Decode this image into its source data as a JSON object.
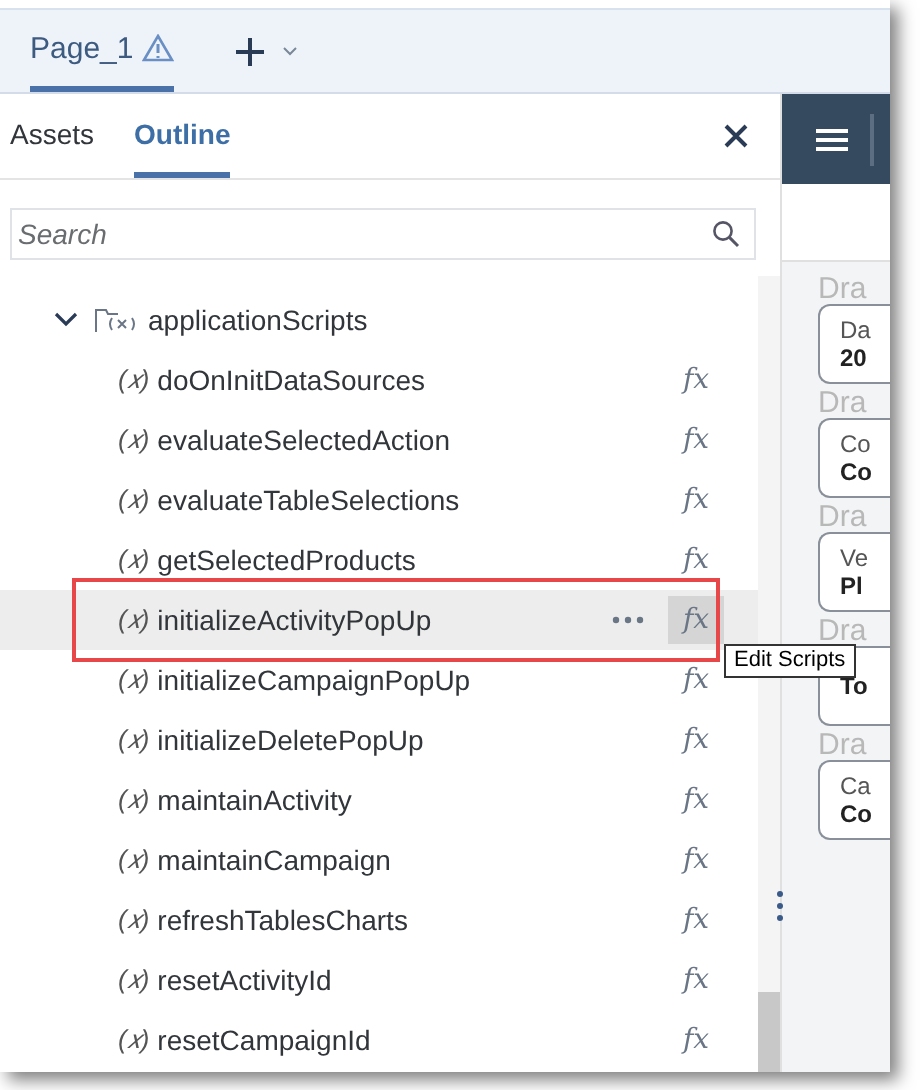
{
  "page_tabs": [
    {
      "label": "Page_1",
      "selected": true,
      "warning": true
    }
  ],
  "panel_tabs": [
    {
      "label": "Assets",
      "selected": false
    },
    {
      "label": "Outline",
      "selected": true
    }
  ],
  "search": {
    "placeholder": "Search"
  },
  "tree": {
    "label": "applicationScripts",
    "expanded": true,
    "children": [
      {
        "glyph": "(𝑥)",
        "label": "doOnInitDataSources",
        "action": "fx",
        "selected": false
      },
      {
        "glyph": "(𝑥)",
        "label": "evaluateSelectedAction",
        "action": "fx",
        "selected": false
      },
      {
        "glyph": "(𝑥)",
        "label": "evaluateTableSelections",
        "action": "fx",
        "selected": false
      },
      {
        "glyph": "(𝑥)",
        "label": "getSelectedProducts",
        "action": "fx",
        "selected": false
      },
      {
        "glyph": "(𝑥)",
        "label": "initializeActivityPopUp",
        "action": "fx",
        "selected": true
      },
      {
        "glyph": "(𝑥)",
        "label": "initializeCampaignPopUp",
        "action": "fx",
        "selected": false
      },
      {
        "glyph": "(𝑥)",
        "label": "initializeDeletePopUp",
        "action": "fx",
        "selected": false
      },
      {
        "glyph": "(𝑥)",
        "label": "maintainActivity",
        "action": "fx",
        "selected": false
      },
      {
        "glyph": "(𝑥)",
        "label": "maintainCampaign",
        "action": "fx",
        "selected": false
      },
      {
        "glyph": "(𝑥)",
        "label": "refreshTablesCharts",
        "action": "fx",
        "selected": false
      },
      {
        "glyph": "(𝑥)",
        "label": "resetActivityId",
        "action": "fx",
        "selected": false
      },
      {
        "glyph": "(𝑥)",
        "label": "resetCampaignId",
        "action": "fx",
        "selected": false
      }
    ]
  },
  "tooltip": "Edit Scripts",
  "side_cards": [
    {
      "section": "Dra",
      "label": "Da",
      "value": "20"
    },
    {
      "section": "Dra",
      "label": "Co",
      "value": "Co"
    },
    {
      "section": "Dra",
      "label": "Ve",
      "value": "Pl"
    },
    {
      "section": "Dra",
      "value": "To"
    },
    {
      "section": "Dra",
      "label": "Ca",
      "value": "Co"
    }
  ]
}
